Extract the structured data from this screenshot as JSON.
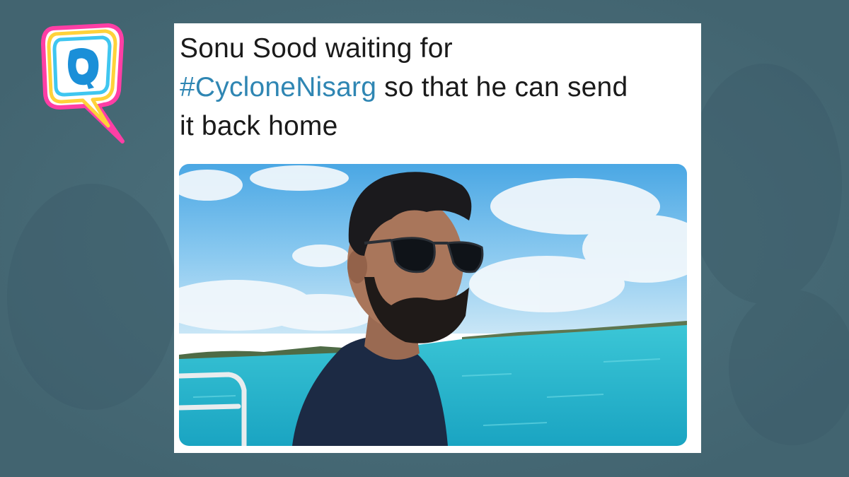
{
  "brand": {
    "logo_letter": "Q",
    "logo_icon": "the-quint-logo-icon"
  },
  "tweet": {
    "line1": "Sonu Sood waiting for",
    "hashtag": "#CycloneNisarg",
    "line2_rest": " so that he can send",
    "line3": "it back home"
  },
  "photo": {
    "icon": "man-sunglasses-sea-photo"
  },
  "colors": {
    "background": "#4c6f7c",
    "hashtag": "#2f86b3",
    "card": "#ffffff"
  }
}
